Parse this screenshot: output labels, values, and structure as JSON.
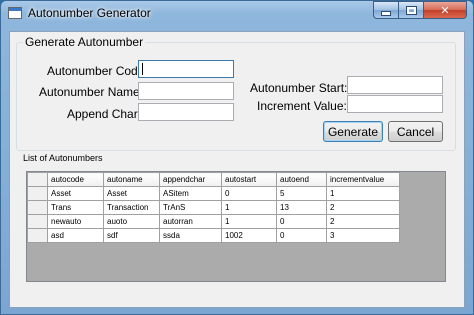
{
  "window": {
    "title": "Autonumber Generator",
    "icons": {
      "app": "app-window-icon",
      "minimize": "minimize-icon",
      "maximize": "maximize-icon",
      "close": "close-icon"
    },
    "close_glyph": "✕"
  },
  "form": {
    "group_title": "Generate Autonumber",
    "autonumber_code_label": "Autonumber Code:",
    "autonumber_code_value": "",
    "autonumber_name_label": "Autonumber Name:",
    "autonumber_name_value": "",
    "append_char_label": "Append Char:",
    "append_char_value": "",
    "autonumber_start_label": "Autonumber Start:",
    "autonumber_start_value": "",
    "increment_value_label": "Increment Value:",
    "increment_value_value": "",
    "generate_label": "Generate",
    "cancel_label": "Cancel"
  },
  "list": {
    "title": "List of Autonumbers",
    "columns": [
      "autocode",
      "autoname",
      "appendchar",
      "autostart",
      "autoend",
      "incrementvalue"
    ],
    "rows": [
      [
        "Asset",
        "Asset",
        "ASitem",
        "0",
        "5",
        "1"
      ],
      [
        "Trans",
        "Transaction",
        "TrAnS",
        "1",
        "13",
        "2"
      ],
      [
        "newauto",
        "auoto",
        "autorran",
        "1",
        "0",
        "2"
      ],
      [
        "asd",
        "sdf",
        "ssda",
        "1002",
        "0",
        "3"
      ]
    ]
  },
  "colors": {
    "titlebar": "#8fb7dc",
    "client": "#f0f0f0",
    "grid_background": "#ababab",
    "close_button": "#c2402a"
  }
}
